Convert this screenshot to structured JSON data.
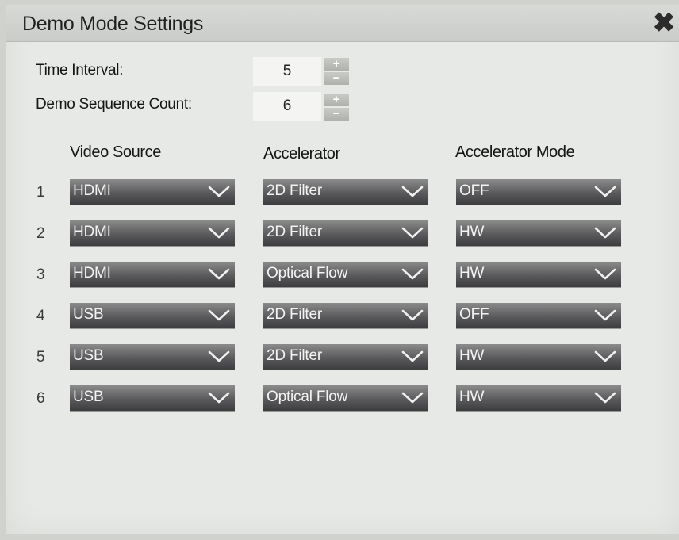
{
  "dialog": {
    "title": "Demo Mode Settings",
    "close_glyph": "✖"
  },
  "time_interval": {
    "label": "Time Interval:",
    "value": "5",
    "plus": "+",
    "minus": "−"
  },
  "sequence_count": {
    "label": "Demo Sequence Count:",
    "value": "6",
    "plus": "+",
    "minus": "−"
  },
  "columns": {
    "video_source": "Video Source",
    "accelerator": "Accelerator",
    "accelerator_mode": "Accelerator Mode"
  },
  "rows": [
    {
      "num": "1",
      "video_source": "HDMI",
      "accelerator": "2D Filter",
      "mode": "OFF"
    },
    {
      "num": "2",
      "video_source": "HDMI",
      "accelerator": "2D Filter",
      "mode": "HW"
    },
    {
      "num": "3",
      "video_source": "HDMI",
      "accelerator": "Optical Flow",
      "mode": "HW"
    },
    {
      "num": "4",
      "video_source": "USB",
      "accelerator": "2D Filter",
      "mode": "OFF"
    },
    {
      "num": "5",
      "video_source": "USB",
      "accelerator": "2D Filter",
      "mode": "HW"
    },
    {
      "num": "6",
      "video_source": "USB",
      "accelerator": "Optical Flow",
      "mode": "HW"
    }
  ],
  "icons": {
    "close": "close-icon",
    "dropdown": "chevron-down-icon"
  }
}
